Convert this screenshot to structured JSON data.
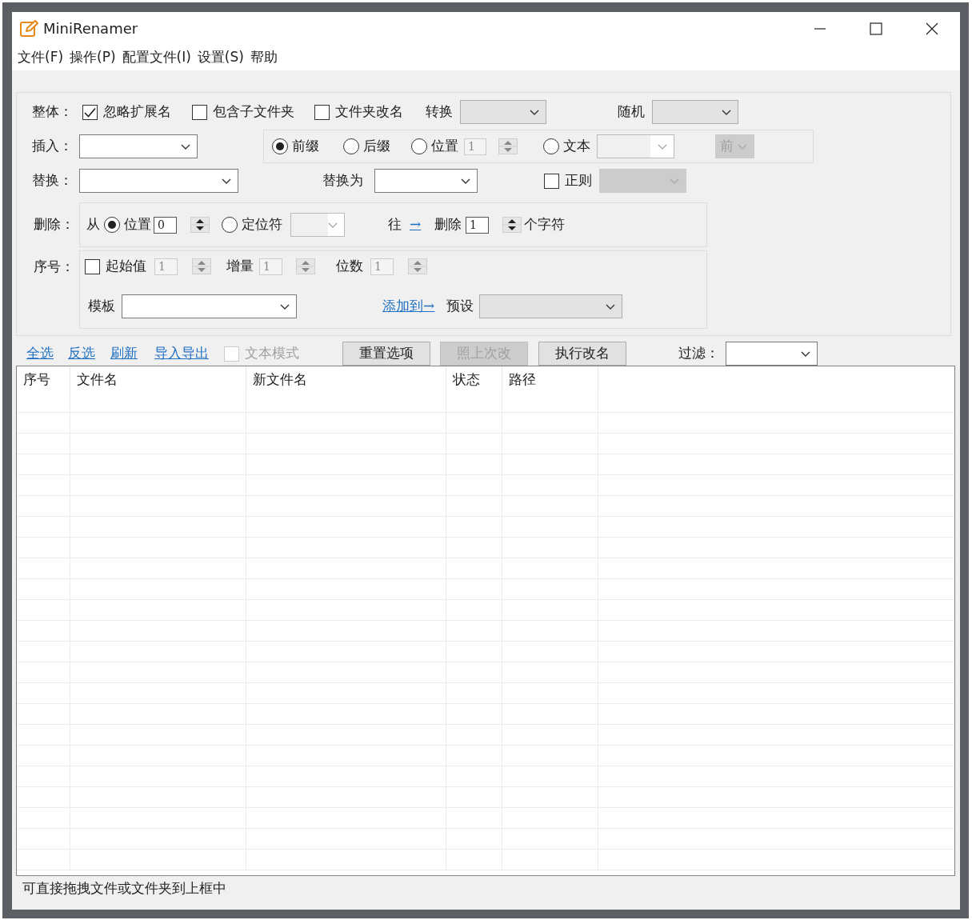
{
  "window": {
    "title": "MiniRenamer"
  },
  "menu": [
    {
      "label": "文件(F)"
    },
    {
      "label": "操作(P)"
    },
    {
      "label": "配置文件(I)"
    },
    {
      "label": "设置(S)"
    },
    {
      "label": "帮助"
    }
  ],
  "overall": {
    "label": "整体：",
    "checkboxes": [
      {
        "label": "忽略扩展名",
        "checked": true
      },
      {
        "label": "包含子文件夹",
        "checked": false
      },
      {
        "label": "文件夹改名",
        "checked": false
      }
    ],
    "convert": {
      "label": "转换",
      "disabled": true
    },
    "random": {
      "label": "随机",
      "disabled": true
    }
  },
  "insert": {
    "label": "插入：",
    "modes": [
      {
        "label": "前缀",
        "selected": true
      },
      {
        "label": "后缀",
        "selected": false
      },
      {
        "label": "位置",
        "selected": false
      },
      {
        "label": "文本",
        "selected": false
      }
    ],
    "position": {
      "value": "1",
      "disabled": true
    },
    "text_dropdown": {
      "disabled": true
    },
    "side": {
      "value": "前",
      "disabled": true
    }
  },
  "replace": {
    "label": "替换：",
    "replace_with_label": "替换为",
    "regex": {
      "label": "正则",
      "checked": false,
      "disabled": true
    }
  },
  "delete": {
    "label": "删除：",
    "from_label": "从",
    "modes": [
      {
        "label": "位置",
        "selected": true
      },
      {
        "label": "定位符",
        "selected": false
      }
    ],
    "position": {
      "value": "0",
      "disabled": false
    },
    "locator_disabled": true,
    "direction_label": "往",
    "direction_arrow": "→",
    "delete_label": "删除",
    "count": {
      "value": "1",
      "disabled": false
    },
    "unit": "个字符"
  },
  "sequence": {
    "label": "序号：",
    "start": {
      "label": "起始值",
      "checked": false,
      "value": "1",
      "disabled": true
    },
    "increment": {
      "label": "增量",
      "value": "1",
      "disabled": true
    },
    "digits": {
      "label": "位数",
      "value": "1",
      "disabled": true
    },
    "template_label": "模板",
    "add_link": "添加到→",
    "preset_label": "预设",
    "preset_disabled": true
  },
  "toolbar": {
    "links": [
      "全选",
      "反选",
      "刷新",
      "导入导出"
    ],
    "text_mode": {
      "label": "文本模式",
      "checked": false,
      "disabled": true
    },
    "buttons": [
      {
        "label": "重置选项",
        "disabled": false
      },
      {
        "label": "照上次改",
        "disabled": true
      },
      {
        "label": "执行改名",
        "disabled": false
      }
    ],
    "filter_label": "过滤："
  },
  "table": {
    "columns": [
      "序号",
      "文件名",
      "新文件名",
      "状态",
      "路径"
    ]
  },
  "status_bar": "可直接拖拽文件或文件夹到上框中"
}
